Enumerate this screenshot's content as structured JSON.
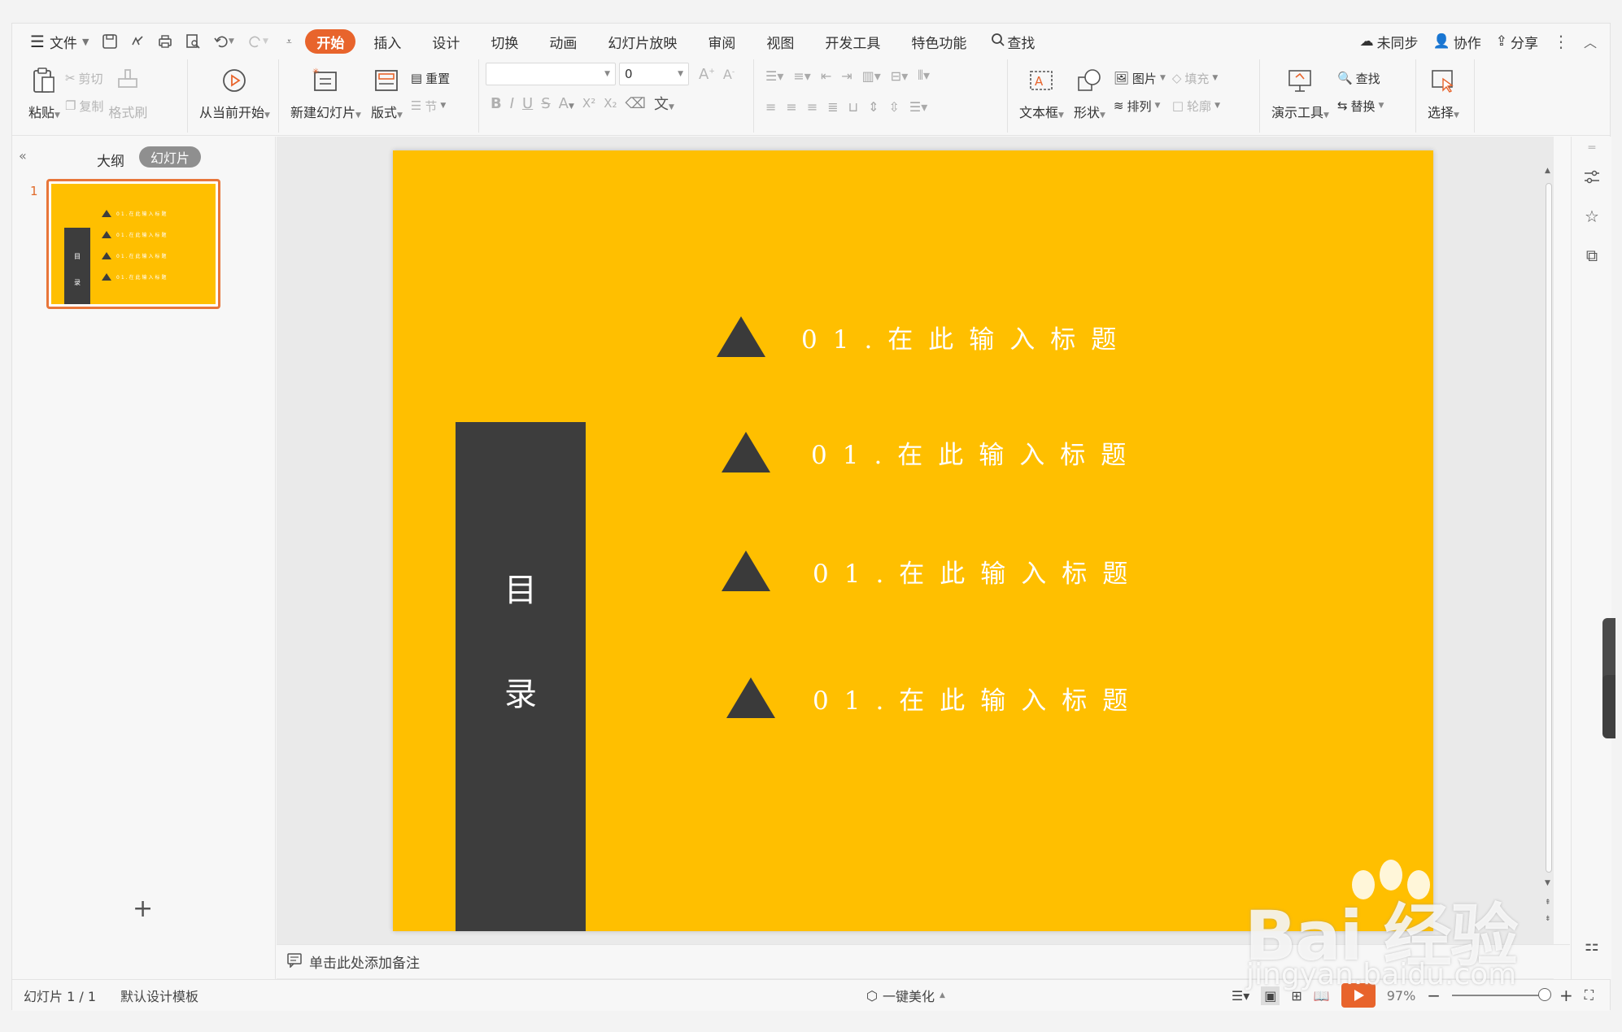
{
  "menubar": {
    "file": "文件",
    "tabs": [
      "开始",
      "插入",
      "设计",
      "切换",
      "动画",
      "幻灯片放映",
      "审阅",
      "视图",
      "开发工具",
      "特色功能"
    ],
    "search": "查找",
    "right": {
      "sync": "未同步",
      "collab": "协作",
      "share": "分享"
    }
  },
  "ribbon": {
    "paste": "粘贴",
    "cut": "剪切",
    "copy": "复制",
    "format_painter": "格式刷",
    "play_from_current": "从当前开始",
    "new_slide": "新建幻灯片",
    "layout": "版式",
    "reset": "重置",
    "section": "节",
    "font_name": "",
    "font_size": "0",
    "textbox": "文本框",
    "shape": "形状",
    "picture": "图片",
    "fill": "填充",
    "arrange": "排列",
    "outline": "轮廓",
    "present_tools": "演示工具",
    "find": "查找",
    "replace": "替换",
    "select": "选择"
  },
  "leftpanel": {
    "tab_outline": "大纲",
    "tab_slides": "幻灯片",
    "slide_number": "1"
  },
  "slide": {
    "sidebar_chars": [
      "目",
      "录"
    ],
    "items": [
      "01.在此输入标题",
      "01.在此输入标题",
      "01.在此输入标题",
      "01.在此输入标题"
    ],
    "colors": {
      "background": "#ffbf00",
      "bar": "#3d3d3d",
      "triangle": "#3a3a3a"
    }
  },
  "notes": {
    "placeholder": "单击此处添加备注"
  },
  "statusbar": {
    "slide_info": "幻灯片 1 / 1",
    "template": "默认设计模板",
    "beautify": "一键美化",
    "zoom": "97%"
  },
  "watermark": {
    "brand": "Bai 经验",
    "url": "jingyan.baidu.com"
  }
}
